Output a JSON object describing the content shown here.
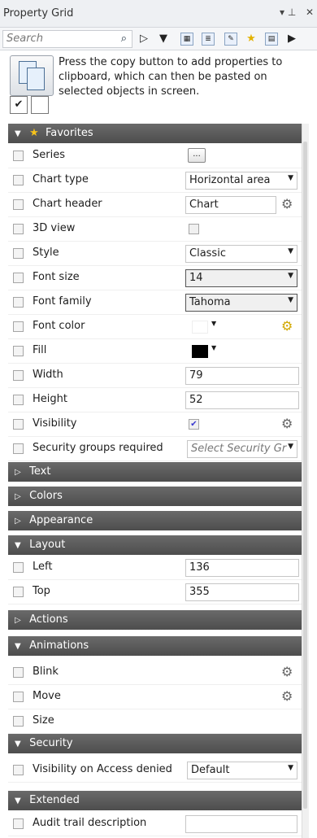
{
  "window": {
    "title": "Property Grid",
    "pin_glyph": "▾ ⊣",
    "close_glyph": "✕"
  },
  "toolbar": {
    "search_placeholder": "Search"
  },
  "info": {
    "text": "Press the copy button to add properties to clipboard, which can then be pasted on selected objects in screen."
  },
  "sections": {
    "favorites": "Favorites",
    "text": "Text",
    "colors": "Colors",
    "appearance": "Appearance",
    "layout": "Layout",
    "actions": "Actions",
    "animations": "Animations",
    "security": "Security",
    "extended": "Extended"
  },
  "favorites": {
    "series": {
      "label": "Series",
      "value": "..."
    },
    "chart_type": {
      "label": "Chart type",
      "value": "Horizontal area"
    },
    "chart_header": {
      "label": "Chart header",
      "value": "Chart"
    },
    "view_3d": {
      "label": "3D view"
    },
    "style": {
      "label": "Style",
      "value": "Classic"
    },
    "font_size": {
      "label": "Font size",
      "value": "14"
    },
    "font_family": {
      "label": "Font family",
      "value": "Tahoma"
    },
    "font_color": {
      "label": "Font color",
      "color": "#ffffff"
    },
    "fill": {
      "label": "Fill",
      "color": "#000000"
    },
    "width": {
      "label": "Width",
      "value": "79"
    },
    "height": {
      "label": "Height",
      "value": "52"
    },
    "visibility": {
      "label": "Visibility",
      "checked": true
    },
    "security_groups": {
      "label": "Security groups required",
      "placeholder": "Select Security Gr"
    }
  },
  "layout": {
    "left": {
      "label": "Left",
      "value": "136"
    },
    "top": {
      "label": "Top",
      "value": "355"
    }
  },
  "animations": {
    "blink": {
      "label": "Blink"
    },
    "move": {
      "label": "Move"
    },
    "size": {
      "label": "Size"
    }
  },
  "security": {
    "visibility_access_denied": {
      "label": "Visibility on Access denied",
      "value": "Default"
    }
  },
  "extended": {
    "audit_trail": {
      "label": "Audit trail description",
      "value": ""
    }
  },
  "colors": {
    "section_bg": "#575757",
    "star": "#f7c31b",
    "gear_gold": "#d2a800"
  }
}
